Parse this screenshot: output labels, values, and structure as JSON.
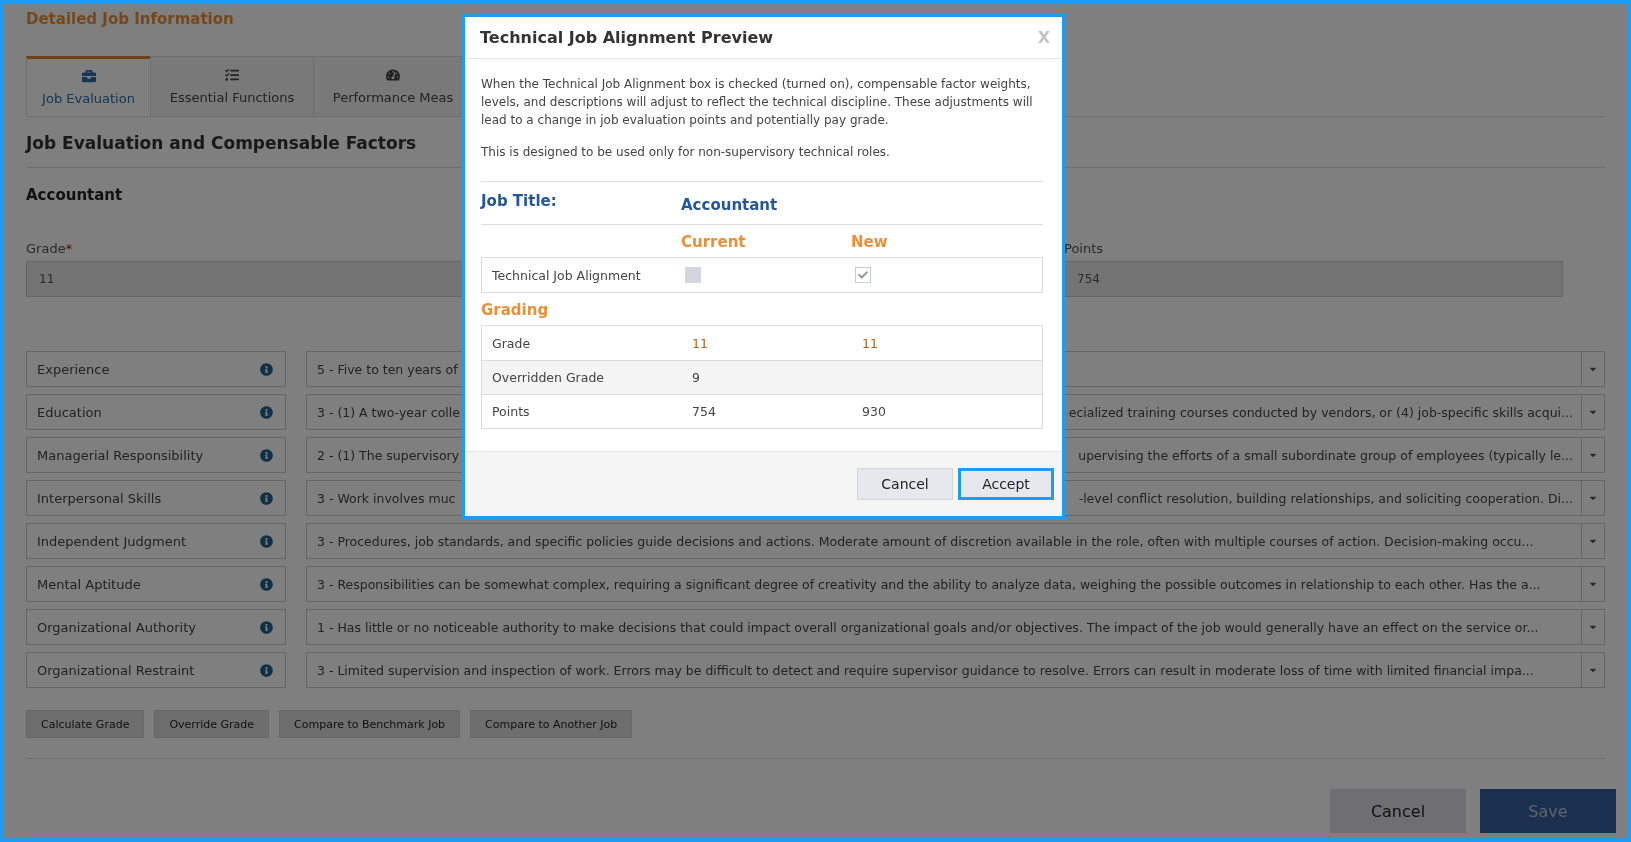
{
  "window": {
    "title": "Detailed Job Information"
  },
  "tabs": [
    {
      "label": "Job Evaluation",
      "selected": true
    },
    {
      "label": "Essential Functions",
      "selected": false
    },
    {
      "label": "Performance Meas",
      "selected": false
    }
  ],
  "section_title": "Job Evaluation and Compensable Factors",
  "job_name": "Accountant",
  "grade": {
    "label": "Grade",
    "required_mark": "*",
    "value": "11"
  },
  "points": {
    "label": "Points",
    "value": "754"
  },
  "factors": [
    {
      "name": "Experience",
      "value_start": "5 - Five to ten years of"
    },
    {
      "name": "Education",
      "value_start": "3 - (1) A two-year colle",
      "value_end": "ecialized training courses conducted by vendors, or (4) job-specific skills acqui..."
    },
    {
      "name": "Managerial Responsibility",
      "value_start": "2 - (1) The supervisory",
      "value_end": "upervising the efforts of a small subordinate group of employees (typically le..."
    },
    {
      "name": "Interpersonal Skills",
      "value_start": "3 - Work involves muc",
      "value_end": "-level conflict resolution, building relationships, and soliciting cooperation. Di..."
    },
    {
      "name": "Independent Judgment",
      "value": "3 - Procedures, job standards, and specific policies guide decisions and actions. Moderate amount of discretion available in the role, often with multiple courses of action. Decision-making occu..."
    },
    {
      "name": "Mental Aptitude",
      "value": "3 - Responsibilities can be somewhat complex, requiring a significant degree of creativity and the ability to analyze data, weighing the possible outcomes in relationship to each other. Has the a..."
    },
    {
      "name": "Organizational Authority",
      "value": "1 - Has little or no noticeable authority to make decisions that could impact overall organizational goals and/or objectives. The impact of the job would generally have an effect on the service or..."
    },
    {
      "name": "Organizational Restraint",
      "value": "3 - Limited supervision and inspection of work. Errors may be difficult to detect and require supervisor guidance to resolve. Errors can result in moderate loss of time with limited financial impa..."
    }
  ],
  "actions": [
    "Calculate Grade",
    "Override Grade",
    "Compare to Benchmark Job",
    "Compare to Another Job"
  ],
  "footer_buttons": [
    {
      "label": "Cancel",
      "kind": "secondary"
    },
    {
      "label": "Save",
      "kind": "primary"
    }
  ],
  "dialog": {
    "title": "Technical Job Alignment Preview",
    "close": "X",
    "paragraphs": [
      "When the Technical Job Alignment box is checked (turned on), compensable factor weights, levels, and descriptions will adjust to reflect the technical discipline. These adjustments will lead to a change in job evaluation points and potentially pay grade.",
      "This is designed to be used only for non-supervisory technical roles."
    ],
    "job_title_label": "Job Title:",
    "job_title": "Accountant",
    "columns": [
      "Current",
      "New"
    ],
    "alignment": {
      "label": "Technical Job Alignment",
      "current_checked": false,
      "new_checked": true
    },
    "grading_title": "Grading",
    "grading_rows": [
      {
        "label": "Grade",
        "current": "11",
        "new": "11"
      },
      {
        "label": "Overridden Grade",
        "current": "9"
      },
      {
        "label": "Points",
        "current": "754",
        "new": "930"
      }
    ],
    "buttons": [
      {
        "label": "Cancel",
        "focused": false
      },
      {
        "label": "Accept",
        "focused": true
      }
    ]
  }
}
